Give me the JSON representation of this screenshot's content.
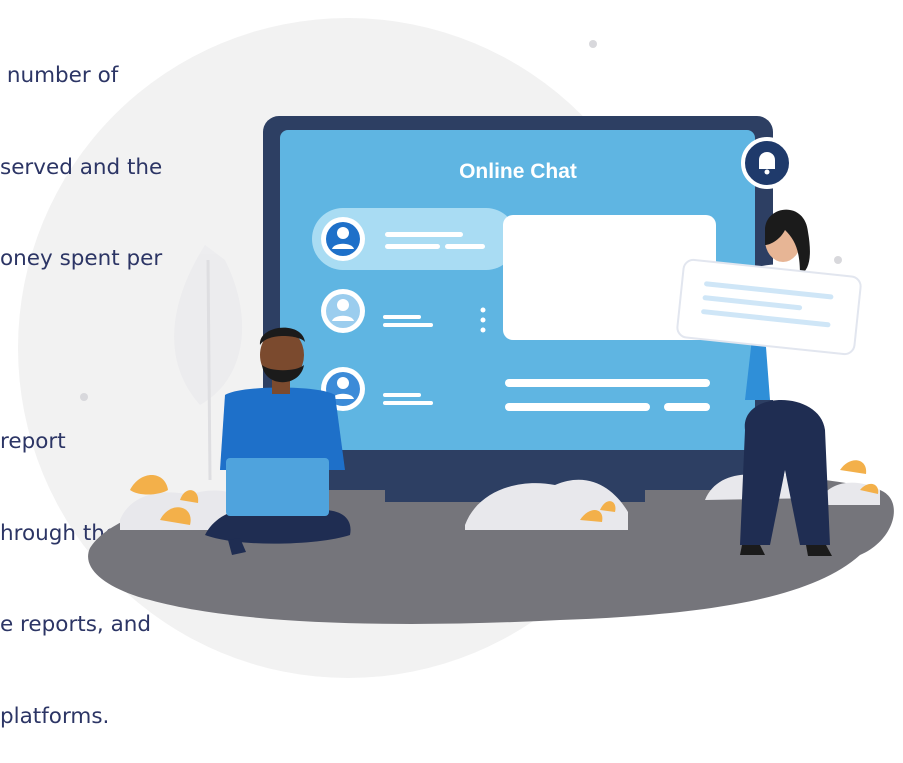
{
  "text_block": {
    "lines": [
      " number of",
      "served and the",
      "oney spent per",
      "",
      "report",
      "hrough the city",
      "e reports, and",
      "platforms."
    ]
  },
  "illustration": {
    "screen_title": "Online Chat",
    "bell_icon": "bell-icon",
    "colors": {
      "bezel": "#2d3f63",
      "screen": "#5fb5e2",
      "accent": "#1e70c9",
      "ground": "#7a7a80",
      "plants": "#f3b04a",
      "text": "#2c3565"
    }
  }
}
